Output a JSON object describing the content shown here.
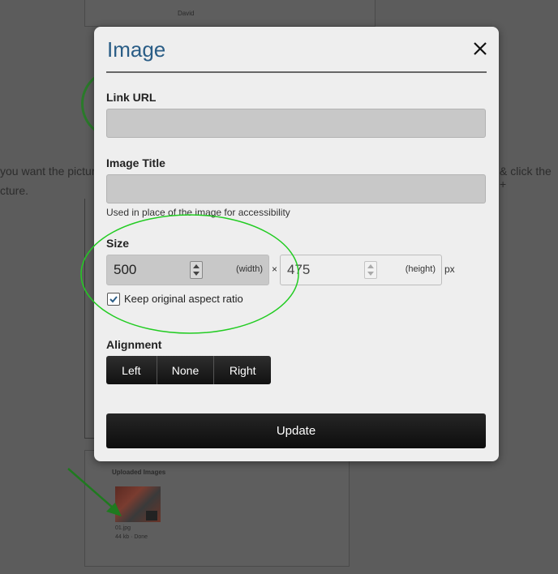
{
  "background": {
    "author": "David",
    "text_line_1": "you want the pictur",
    "text_line_2": "cture.",
    "text_right": "& click the +",
    "uploads_title": "Uploaded Images",
    "file_name": "01.jpg",
    "file_meta": "44 kb · Done"
  },
  "dialog": {
    "title": "Image",
    "link_url": {
      "label": "Link URL",
      "value": ""
    },
    "image_title": {
      "label": "Image Title",
      "value": "",
      "help": "Used in place of the image for accessibility"
    },
    "size": {
      "label": "Size",
      "width_value": "500",
      "width_hint": "(width)",
      "times": "×",
      "height_value": "475",
      "height_hint": "(height)",
      "unit": "px",
      "keep_ratio_label": "Keep original aspect ratio",
      "keep_ratio_checked": true
    },
    "alignment": {
      "label": "Alignment",
      "options": [
        "Left",
        "None",
        "Right"
      ]
    },
    "update_label": "Update"
  },
  "colors": {
    "title": "#2a5d86",
    "annotation": "#22cc22",
    "overlay": "#5c5c5c"
  }
}
